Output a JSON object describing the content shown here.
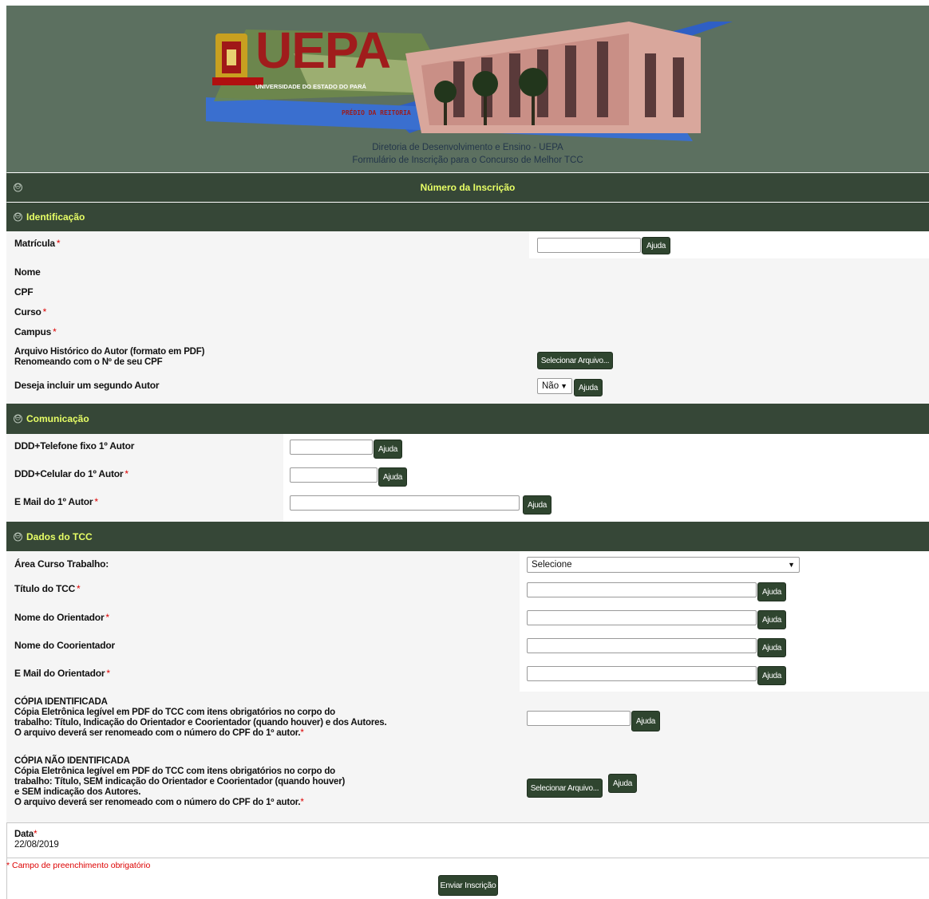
{
  "banner": {
    "logo_text": "UEPA",
    "logo_subtitle": "UNIVERSIDADE DO ESTADO DO PARÁ",
    "building_caption": "PRÉDIO DA REITORIA",
    "line1": "Diretoria de Desenvolvimento e Ensino - UEPA",
    "line2": "Formulário de Inscrição para o Concurso de Melhor TCC"
  },
  "inscricao": {
    "title": "Número da Inscrição"
  },
  "identificacao": {
    "title": "Identificação",
    "matricula": "Matrícula",
    "nome": "Nome",
    "cpf": "CPF",
    "curso": "Curso",
    "campus": "Campus",
    "arquivo_line1": "Arquivo Histórico do Autor (formato em PDF)",
    "arquivo_line2": "Renomeando com o Nº de seu CPF",
    "segundo_autor": "Deseja incluir um segundo Autor",
    "segundo_autor_value": "Não",
    "select_file": "Selecionar Arquivo..."
  },
  "comunicacao": {
    "title": "Comunicação",
    "telefone": "DDD+Telefone fixo 1º Autor",
    "celular": "DDD+Celular do 1º Autor",
    "email": "E Mail do 1º Autor"
  },
  "tcc": {
    "title": "Dados do TCC",
    "area": "Área Curso Trabalho:",
    "area_value": "Selecione",
    "titulo": "Título do TCC",
    "orientador": "Nome do Orientador",
    "coorientador": "Nome do Coorientador",
    "email_orientador": "E Mail do Orientador",
    "copia_id_1": "CÓPIA IDENTIFICADA",
    "copia_id_2": "Cópia Eletrônica legível em PDF do TCC com itens obrigatórios no corpo do",
    "copia_id_3": "trabalho: Título, Indicação do Orientador e Coorientador (quando houver) e dos Autores.",
    "copia_id_4": "O arquivo deverá ser renomeado com o número do CPF do 1º autor.",
    "copia_nid_1": "CÓPIA NÃO IDENTIFICADA",
    "copia_nid_2": "Cópia Eletrônica legível em PDF do TCC com itens obrigatórios no corpo do",
    "copia_nid_3": "trabalho: Título, SEM indicação do Orientador e Coorientador (quando houver)",
    "copia_nid_4": "e SEM indicação dos Autores.",
    "copia_nid_5": "O arquivo deverá ser renomeado com o número do CPF do 1º autor.",
    "select_file": "Selecionar Arquivo..."
  },
  "data": {
    "label": "Data",
    "value": "22/08/2019"
  },
  "common": {
    "required_mark": "*",
    "help": "Ajuda",
    "toggle": "⊖"
  },
  "footer": {
    "required_note": "* Campo de preenchimento obrigatório",
    "submit": "Enviar Inscrição"
  },
  "colors": {
    "header_bar": "#364737",
    "header_text": "#e8ff66",
    "banner_bg": "#5c7060",
    "button": "#2f452f",
    "required": "#dd0000"
  }
}
